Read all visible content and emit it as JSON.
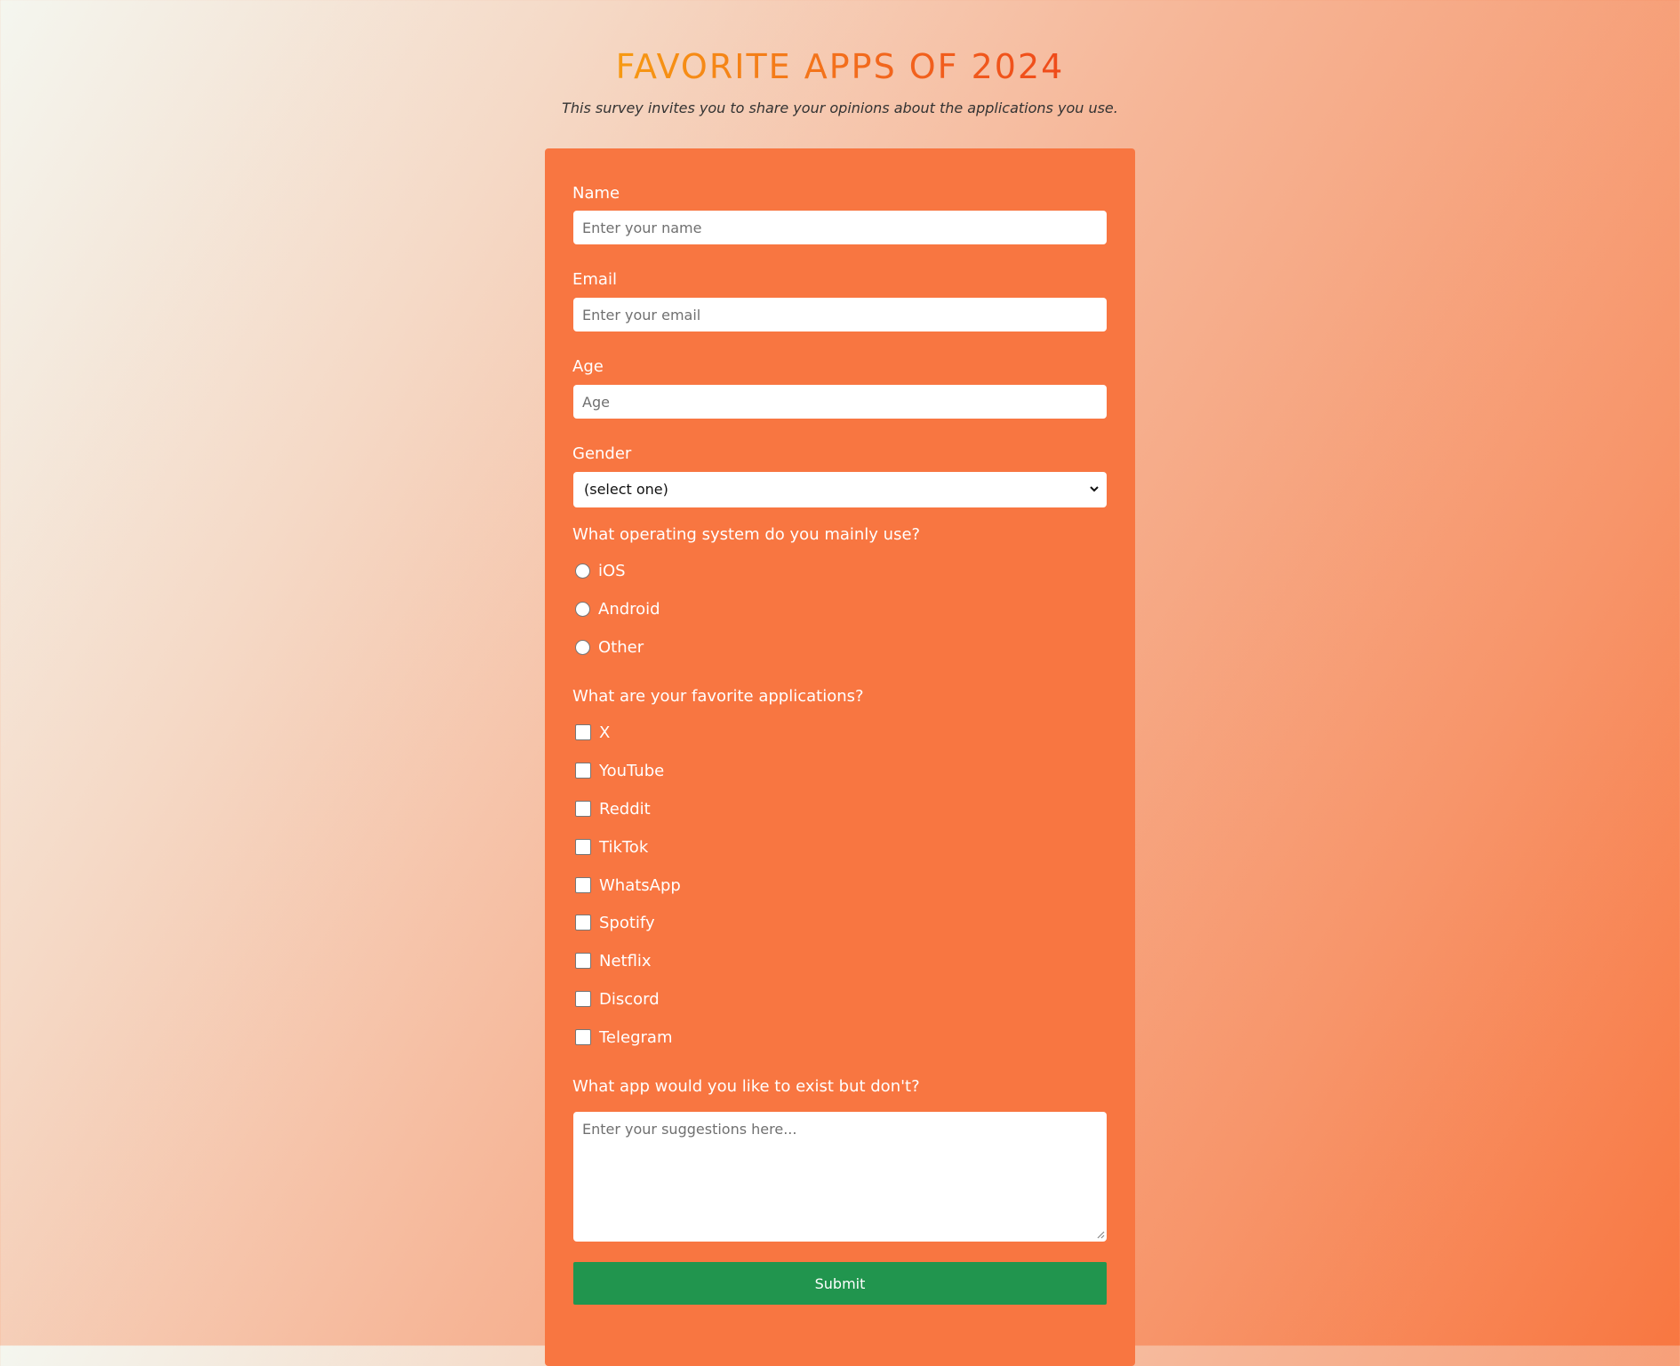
{
  "header": {
    "title": "FAVORITE APPS OF 2024",
    "subtitle": "This survey invites you to share your opinions about the applications you use."
  },
  "form": {
    "name": {
      "label": "Name",
      "placeholder": "Enter your name"
    },
    "email": {
      "label": "Email",
      "placeholder": "Enter your email"
    },
    "age": {
      "label": "Age",
      "placeholder": "Age"
    },
    "gender": {
      "label": "Gender",
      "selected": "(select one)"
    },
    "os_question": {
      "label": "What operating system do you mainly use?",
      "options": [
        "iOS",
        "Android",
        "Other"
      ]
    },
    "apps_question": {
      "label": "What are your favorite applications?",
      "options": [
        "X",
        "YouTube",
        "Reddit",
        "TikTok",
        "WhatsApp",
        "Spotify",
        "Netflix",
        "Discord",
        "Telegram"
      ]
    },
    "suggestion": {
      "label": "What app would you like to exist but don't?",
      "placeholder": "Enter your suggestions here..."
    },
    "submit_label": "Submit"
  },
  "colors": {
    "card": "#f87641",
    "submit": "#21954e",
    "title_start": "#f79a12",
    "title_end": "#ef4a1a"
  }
}
